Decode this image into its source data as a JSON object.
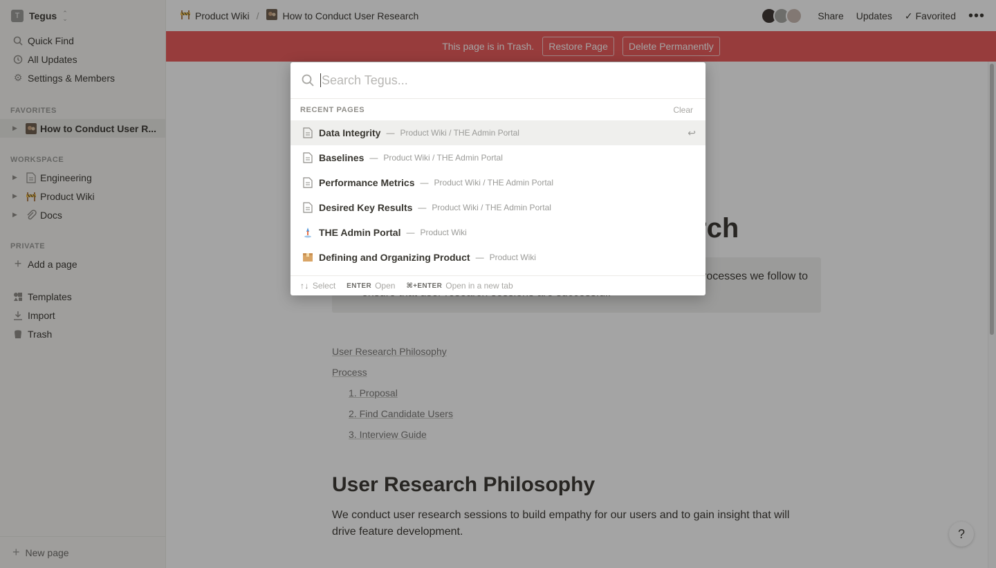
{
  "workspace": {
    "initial": "T",
    "name": "Tegus"
  },
  "sidebar": {
    "top_items": [
      {
        "label": "Quick Find",
        "icon": "search-icon"
      },
      {
        "label": "All Updates",
        "icon": "clock-icon"
      },
      {
        "label": "Settings & Members",
        "icon": "gear-icon"
      }
    ],
    "favorites_header": "FAVORITES",
    "favorites": [
      {
        "label": "How to Conduct User R..."
      }
    ],
    "workspace_header": "WORKSPACE",
    "workspace_items": [
      {
        "label": "Engineering"
      },
      {
        "label": "Product Wiki"
      },
      {
        "label": "Docs"
      }
    ],
    "private_header": "PRIVATE",
    "add_page": "Add a page",
    "bottom_items": [
      {
        "label": "Templates"
      },
      {
        "label": "Import"
      },
      {
        "label": "Trash"
      }
    ],
    "new_page": "New page"
  },
  "topbar": {
    "breadcrumb": [
      "Product Wiki",
      "How to Conduct User Research"
    ],
    "separator": "/",
    "share": "Share",
    "updates": "Updates",
    "favorited": "Favorited"
  },
  "banner": {
    "message": "This page is in Trash.",
    "restore": "Restore Page",
    "delete": "Delete Permanently",
    "color": "#eb5757"
  },
  "page": {
    "title_fragment": "rch",
    "callout_line1": "rocesses we follow to",
    "callout_line2": "ensure that user research sessions are successful.",
    "toc": [
      "User Research Philosophy",
      "Process",
      "1. Proposal",
      "2. Find Candidate Users",
      "3. Interview Guide"
    ],
    "heading": "User Research Philosophy",
    "paragraph": "We conduct user research sessions to build empathy for our users and to gain insight that will drive feature development."
  },
  "search": {
    "placeholder": "Search Tegus...",
    "recent_header": "RECENT PAGES",
    "clear": "Clear",
    "dash": "—",
    "results": [
      {
        "title": "Data Integrity",
        "path": "Product Wiki / THE Admin Portal",
        "icon": "page-icon"
      },
      {
        "title": "Baselines",
        "path": "Product Wiki / THE Admin Portal",
        "icon": "page-icon"
      },
      {
        "title": "Performance Metrics",
        "path": "Product Wiki / THE Admin Portal",
        "icon": "page-icon"
      },
      {
        "title": "Desired Key Results",
        "path": "Product Wiki / THE Admin Portal",
        "icon": "page-icon"
      },
      {
        "title": "THE Admin Portal",
        "path": "Product Wiki",
        "icon": "portal-icon"
      },
      {
        "title": "Defining and Organizing Product",
        "path": "Product Wiki",
        "icon": "box-icon"
      }
    ],
    "footer": {
      "select_key": "↑↓",
      "select_label": "Select",
      "enter_key": "ENTER",
      "enter_label": "Open",
      "newtab_key": "⌘+ENTER",
      "newtab_label": "Open in a new tab"
    }
  },
  "help": "?"
}
